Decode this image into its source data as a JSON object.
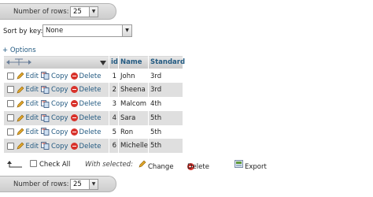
{
  "top_nav": {
    "label": "Number of rows:",
    "value": "25"
  },
  "bottom_nav": {
    "label": "Number of rows:",
    "value": "25"
  },
  "sort": {
    "label": "Sort by key:",
    "value": "None"
  },
  "options_link": "+ Options",
  "table": {
    "headers": [
      "id",
      "Name",
      "Standard"
    ],
    "row_actions": {
      "edit": "Edit",
      "copy": "Copy",
      "delete": "Delete"
    },
    "rows": [
      {
        "id": "1",
        "name": "John",
        "standard": "3rd"
      },
      {
        "id": "2",
        "name": "Sheena",
        "standard": "3rd"
      },
      {
        "id": "3",
        "name": "Malcom",
        "standard": "4th"
      },
      {
        "id": "4",
        "name": "Sara",
        "standard": "5th"
      },
      {
        "id": "5",
        "name": "Ron",
        "standard": "5th"
      },
      {
        "id": "6",
        "name": "Michelle",
        "standard": "5th"
      }
    ]
  },
  "bulk": {
    "check_all": "Check All",
    "with_selected": "With selected:",
    "change": "Change",
    "delete": "Delete",
    "export": "Export"
  },
  "colors": {
    "link": "#235a81",
    "delete_icon": "#d8322b",
    "row_alt": "#dfdfdf"
  }
}
